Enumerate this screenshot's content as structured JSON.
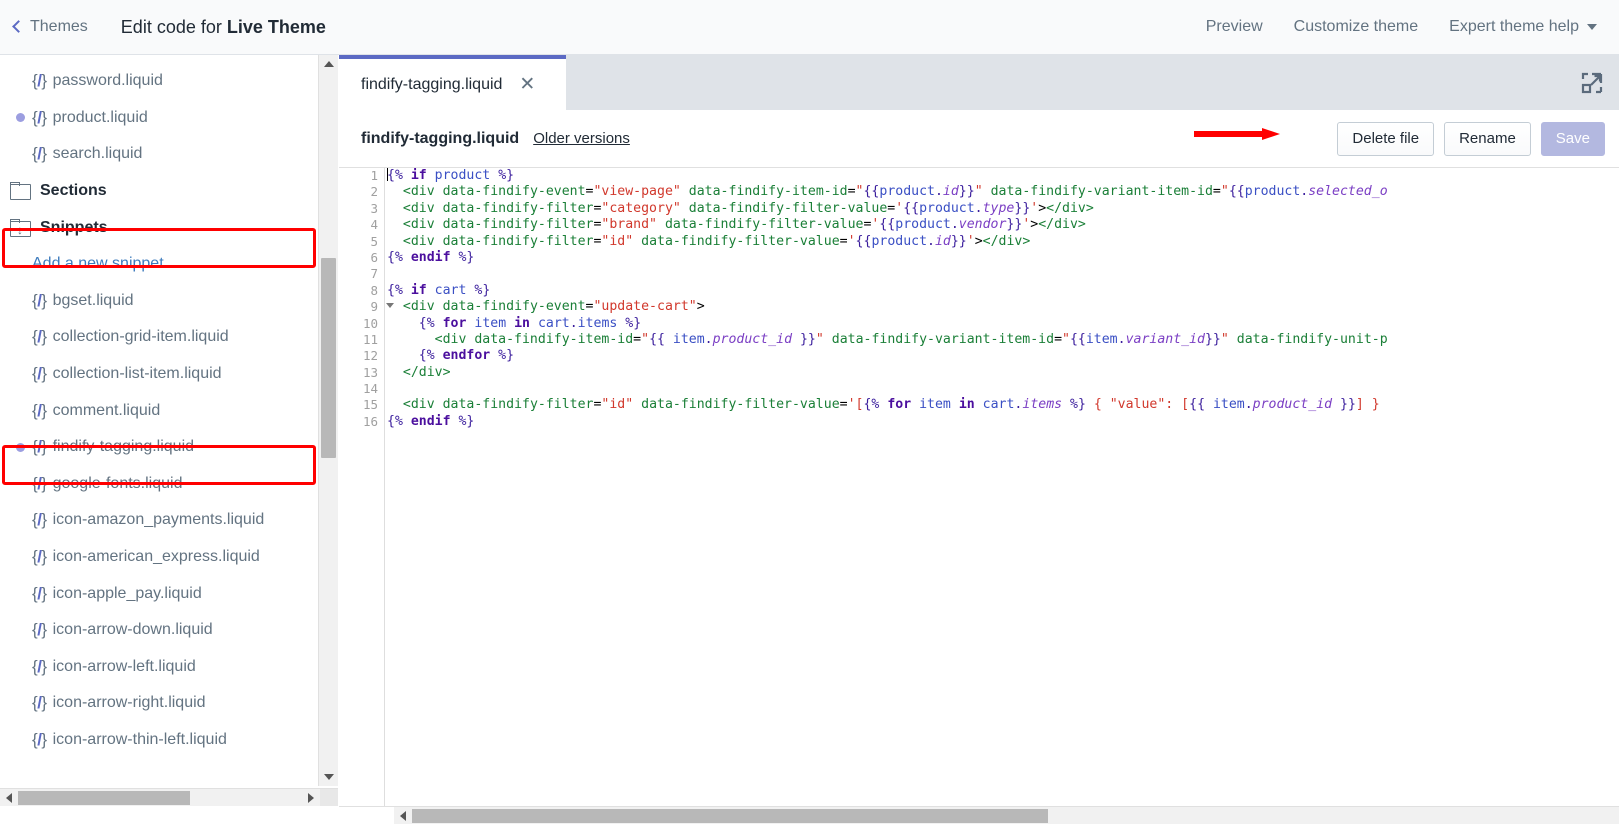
{
  "topbar": {
    "back_label": "Themes",
    "title_prefix": "Edit code for ",
    "title_theme": "Live Theme",
    "links": [
      {
        "label": "Preview",
        "name": "preview-link"
      },
      {
        "label": "Customize theme",
        "name": "customize-theme-link"
      },
      {
        "label": "Expert theme help",
        "name": "expert-theme-help-menu"
      }
    ]
  },
  "sidebar": {
    "items": [
      {
        "label": "password.liquid",
        "type": "file",
        "modified": false,
        "highlight": false
      },
      {
        "label": "product.liquid",
        "type": "file",
        "modified": true,
        "highlight": false
      },
      {
        "label": "search.liquid",
        "type": "file",
        "modified": false,
        "highlight": false
      },
      {
        "label": "Sections",
        "type": "folder",
        "modified": false,
        "highlight": false,
        "folder_state": "closed"
      },
      {
        "label": "Snippets",
        "type": "folder",
        "modified": false,
        "highlight": true,
        "folder_state": "open"
      },
      {
        "label": "Add a new snippet",
        "type": "action",
        "modified": false,
        "highlight": false
      },
      {
        "label": "bgset.liquid",
        "type": "file",
        "modified": false,
        "highlight": false
      },
      {
        "label": "collection-grid-item.liquid",
        "type": "file",
        "modified": false,
        "highlight": false
      },
      {
        "label": "collection-list-item.liquid",
        "type": "file",
        "modified": false,
        "highlight": false
      },
      {
        "label": "comment.liquid",
        "type": "file",
        "modified": false,
        "highlight": false
      },
      {
        "label": "findify-tagging.liquid",
        "type": "file",
        "modified": true,
        "highlight": true
      },
      {
        "label": "google-fonts.liquid",
        "type": "file",
        "modified": false,
        "highlight": false
      },
      {
        "label": "icon-amazon_payments.liquid",
        "type": "file",
        "modified": false,
        "highlight": false
      },
      {
        "label": "icon-american_express.liquid",
        "type": "file",
        "modified": false,
        "highlight": false
      },
      {
        "label": "icon-apple_pay.liquid",
        "type": "file",
        "modified": false,
        "highlight": false
      },
      {
        "label": "icon-arrow-down.liquid",
        "type": "file",
        "modified": false,
        "highlight": false
      },
      {
        "label": "icon-arrow-left.liquid",
        "type": "file",
        "modified": false,
        "highlight": false
      },
      {
        "label": "icon-arrow-right.liquid",
        "type": "file",
        "modified": false,
        "highlight": false
      },
      {
        "label": "icon-arrow-thin-left.liquid",
        "type": "file",
        "modified": false,
        "highlight": false
      }
    ]
  },
  "editor": {
    "tab_label": "findify-tagging.liquid",
    "tab_close": "✕",
    "file_name": "findify-tagging.liquid",
    "older_versions_label": "Older versions",
    "buttons": {
      "delete": "Delete file",
      "rename": "Rename",
      "save": "Save"
    }
  },
  "code": {
    "language": "liquid",
    "line_numbers": [
      1,
      2,
      3,
      4,
      5,
      6,
      7,
      8,
      9,
      10,
      11,
      12,
      13,
      14,
      15,
      16
    ],
    "fold_marker_line": 9,
    "lines": [
      "{% if product %}",
      "  <div data-findify-event=\"view-page\" data-findify-item-id=\"{{product.id}}\" data-findify-variant-item-id=\"{{product.selected_o",
      "  <div data-findify-filter=\"category\" data-findify-filter-value='{{product.type}}'></div>",
      "  <div data-findify-filter=\"brand\" data-findify-filter-value='{{product.vendor}}'></div>",
      "  <div data-findify-filter=\"id\" data-findify-filter-value='{{product.id}}'></div>",
      "{% endif %}",
      "",
      "{% if cart %}",
      "  <div data-findify-event=\"update-cart\">",
      "    {% for item in cart.items %}",
      "      <div data-findify-item-id=\"{{ item.product_id }}\" data-findify-variant-item-id=\"{{item.variant_id}}\" data-findify-unit-p",
      "    {% endfor %}",
      "  </div>",
      "",
      "  <div data-findify-filter=\"id\" data-findify-filter-value='[{% for item in cart.items %} { \"value\": [{{ item.product_id }}] } ",
      "{% endif %}"
    ]
  },
  "annotations": {
    "arrow_color": "#ff0000",
    "highlight_color": "#ff0000",
    "arrow_points_to": "Delete file"
  },
  "icons": {
    "file": "{/}",
    "expand": "expand-icon",
    "back_chevron": "chevron-left-icon",
    "dropdown_caret": "chevron-down-icon"
  }
}
